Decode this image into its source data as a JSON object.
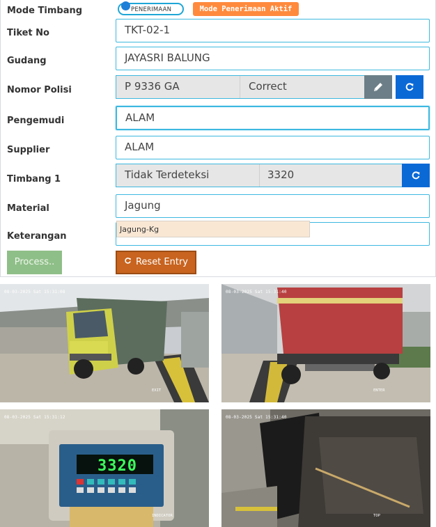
{
  "form": {
    "labels": {
      "mode": "Mode Timbang",
      "tiket": "Tiket No",
      "gudang": "Gudang",
      "nopol": "Nomor Polisi",
      "pengemudi": "Pengemudi",
      "supplier": "Supplier",
      "timbang1": "Timbang 1",
      "material": "Material",
      "keterangan": "Keterangan"
    },
    "mode_toggle": "PENERIMAAN",
    "mode_badge": "Mode Penerimaan Aktif",
    "tiket_value": "TKT-02-1",
    "gudang_value": "JAYASRI BALUNG",
    "nopol_value": "P 9336 GA",
    "nopol_status": "Correct",
    "pengemudi_value": "ALAM",
    "supplier_value": "ALAM",
    "timbang_status": "Tidak Terdeteksi",
    "timbang_value": "3320",
    "material_value": "Jagung",
    "material_suggestion": "Jagung-Kg",
    "keterangan_value": ""
  },
  "buttons": {
    "process": "Process..",
    "reset": "Reset Entry"
  },
  "cameras": [
    {
      "timestamp": "08-03-2025 Sat 15:31:08",
      "tag": "EXIT",
      "display": ""
    },
    {
      "timestamp": "08-03-2025 Sat 15:31:40",
      "tag": "ENTER",
      "display": ""
    },
    {
      "timestamp": "08-03-2025 Sat 15:31:12",
      "tag": "INDICATOR",
      "display": "3320"
    },
    {
      "timestamp": "08-03-2025 Sat 15:31:40",
      "tag": "TOP",
      "display": ""
    }
  ],
  "colors": {
    "accent": "#3db8e0",
    "badge": "#ff8a3d",
    "blue_button": "#0b69d6",
    "reset": "#c8641f",
    "process": "#8fbf88"
  }
}
